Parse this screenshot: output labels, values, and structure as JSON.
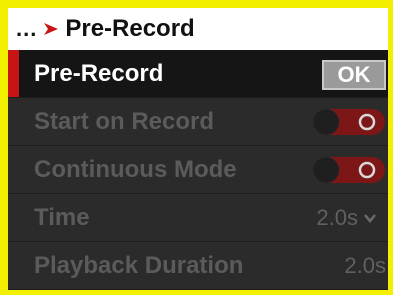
{
  "header": {
    "breadcrumb_prefix": "...",
    "title": "Pre-Record"
  },
  "rows": {
    "pre_record": {
      "label": "Pre-Record",
      "button": "OK"
    },
    "start_on_record": {
      "label": "Start on Record",
      "toggle": "on"
    },
    "continuous_mode": {
      "label": "Continuous Mode",
      "toggle": "on"
    },
    "time": {
      "label": "Time",
      "value": "2.0s"
    },
    "playback_duration": {
      "label": "Playback Duration",
      "value": "2.0s"
    }
  },
  "colors": {
    "frame_border": "#f2ef00",
    "accent": "#c81414",
    "toggle_red": "#7d1616"
  },
  "icons": {
    "breadcrumb_arrow": "chevron-right-icon",
    "dropdown": "chevron-down-icon"
  }
}
